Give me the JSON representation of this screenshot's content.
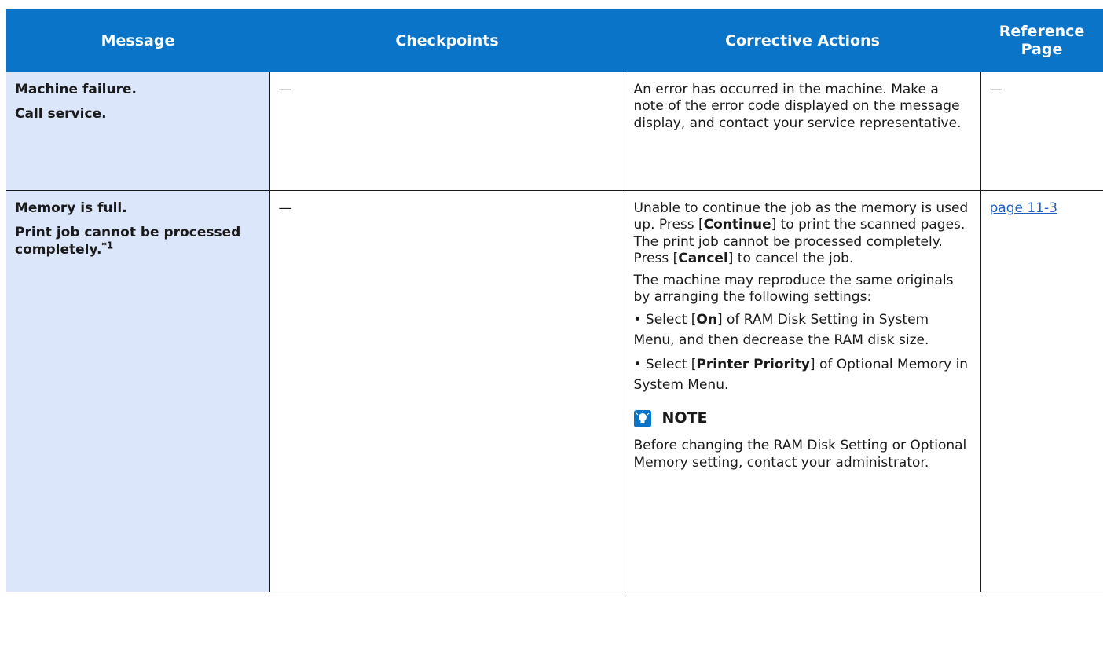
{
  "headers": {
    "message": "Message",
    "checkpoints": "Checkpoints",
    "corrective": "Corrective Actions",
    "reference_1": "Reference",
    "reference_2": "Page"
  },
  "rows": [
    {
      "message_line1": "Machine failure.",
      "message_line2": "Call service.",
      "checkpoints": "—",
      "action": "An error has occurred in the machine. Make a note of the error code displayed on the message display, and contact your service representative.",
      "reference": "—"
    },
    {
      "message_line1": "Memory is full.",
      "message_line2": "Print job cannot be processed completely.",
      "footnote": "*1",
      "checkpoints": "—",
      "action_p1": {
        "t1": "Unable to continue the job as the memory is used up. Press [",
        "b1": "Continue",
        "t2": "] to print the scanned pages. The print job cannot be processed completely. Press [",
        "b2": "Cancel",
        "t3": "] to cancel the job."
      },
      "action_p2": "The machine may reproduce the same originals by arranging the following settings:",
      "bullet1": {
        "pre": "• Select [",
        "bold": "On",
        "post": "] of RAM Disk Setting in System Menu, and then decrease the RAM disk size."
      },
      "bullet2": {
        "pre": "• Select [",
        "bold": "Printer Priority",
        "post": "] of Optional Memory in System Menu."
      },
      "note_title": "NOTE",
      "note_icon": "note-bulb-icon",
      "note_text": "Before changing the RAM Disk Setting or Optional Memory setting, contact your administrator.",
      "reference": "page 11-3"
    }
  ],
  "colors": {
    "header_bg": "#0a74c9",
    "message_bg": "#dce6fa",
    "link": "#1f5fbf"
  }
}
